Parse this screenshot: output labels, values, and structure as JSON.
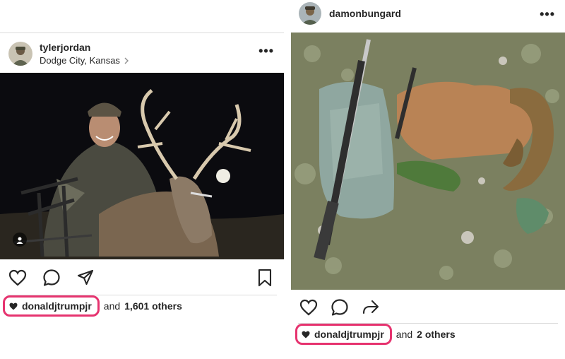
{
  "left_post": {
    "username": "tylerjordan",
    "location": "Dodge City, Kansas",
    "more_label": "•••",
    "actions": [
      "heart-icon",
      "comment-icon",
      "share-icon",
      "bookmark-icon"
    ],
    "liker": "donaldjtrumpjr",
    "likes_suffix": "and",
    "likes_count": "1,601 others",
    "photo_icon": "user-tag-icon"
  },
  "right_post": {
    "username": "damonbungard",
    "more_label": "•••",
    "actions": [
      "heart-icon",
      "comment-icon",
      "share-icon"
    ],
    "liker": "donaldjtrumpjr",
    "likes_suffix": "and",
    "likes_count": "2 others"
  },
  "colors": {
    "highlight": "#e6336f",
    "divider": "#dbdbdb",
    "text": "#262626"
  }
}
